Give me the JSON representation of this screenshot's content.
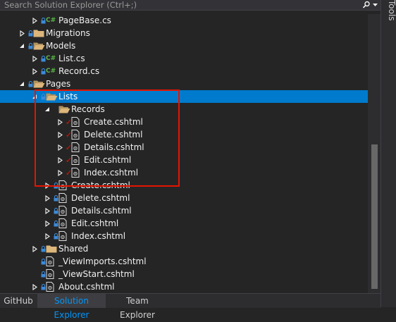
{
  "search": {
    "placeholder": "Search Solution Explorer (Ctrl+;)"
  },
  "side_panel": {
    "label": "Tools"
  },
  "icons": {
    "chevron_collapsed": "chevron-right-outline-icon",
    "chevron_expanded": "chevron-down-filled-icon",
    "lock": "lock-icon",
    "folder": "folder-icon",
    "folder_open": "folder-open-icon",
    "cs_file": "csharp-file-icon",
    "razor_file": "razor-file-icon",
    "pending_edit": "red-checkmark-icon"
  },
  "colors": {
    "background": "#252526",
    "selection": "#007acc",
    "highlight_box": "#e51400",
    "folder": "#dcb67a",
    "cs": "#5ab645",
    "lock": "#3c8ad8",
    "active_tab": "#0097fb"
  },
  "tree": [
    {
      "label": "PageBase.cs",
      "type": "cs",
      "expander": "collapsed",
      "lock": true,
      "checked": false,
      "indent": 3
    },
    {
      "label": "Migrations",
      "type": "folder",
      "expander": "collapsed",
      "lock": true,
      "checked": false,
      "indent": 2
    },
    {
      "label": "Models",
      "type": "folder-open",
      "expander": "expanded",
      "lock": true,
      "checked": false,
      "indent": 2
    },
    {
      "label": "List.cs",
      "type": "cs",
      "expander": "collapsed",
      "lock": true,
      "checked": false,
      "indent": 3
    },
    {
      "label": "Record.cs",
      "type": "cs",
      "expander": "collapsed",
      "lock": true,
      "checked": false,
      "indent": 3
    },
    {
      "label": "Pages",
      "type": "folder-open",
      "expander": "expanded",
      "lock": true,
      "checked": false,
      "indent": 2
    },
    {
      "label": "Lists",
      "type": "folder-open",
      "expander": "expanded",
      "lock": true,
      "checked": false,
      "indent": 3,
      "selected": true
    },
    {
      "label": "Records",
      "type": "folder-open",
      "expander": "expanded",
      "lock": false,
      "checked": false,
      "indent": 4
    },
    {
      "label": "Create.cshtml",
      "type": "razor",
      "expander": "collapsed",
      "lock": false,
      "checked": true,
      "indent": 5
    },
    {
      "label": "Delete.cshtml",
      "type": "razor",
      "expander": "collapsed",
      "lock": false,
      "checked": true,
      "indent": 5
    },
    {
      "label": "Details.cshtml",
      "type": "razor",
      "expander": "collapsed",
      "lock": false,
      "checked": true,
      "indent": 5
    },
    {
      "label": "Edit.cshtml",
      "type": "razor",
      "expander": "collapsed",
      "lock": false,
      "checked": true,
      "indent": 5
    },
    {
      "label": "Index.cshtml",
      "type": "razor",
      "expander": "collapsed",
      "lock": false,
      "checked": true,
      "indent": 5
    },
    {
      "label": "Create.cshtml",
      "type": "razor",
      "expander": "collapsed",
      "lock": true,
      "checked": false,
      "indent": 4
    },
    {
      "label": "Delete.cshtml",
      "type": "razor",
      "expander": "collapsed",
      "lock": true,
      "checked": false,
      "indent": 4
    },
    {
      "label": "Details.cshtml",
      "type": "razor",
      "expander": "collapsed",
      "lock": true,
      "checked": false,
      "indent": 4
    },
    {
      "label": "Edit.cshtml",
      "type": "razor",
      "expander": "collapsed",
      "lock": true,
      "checked": false,
      "indent": 4
    },
    {
      "label": "Index.cshtml",
      "type": "razor",
      "expander": "collapsed",
      "lock": true,
      "checked": false,
      "indent": 4
    },
    {
      "label": "Shared",
      "type": "folder",
      "expander": "collapsed",
      "lock": true,
      "checked": false,
      "indent": 3
    },
    {
      "label": "_ViewImports.cshtml",
      "type": "razor",
      "expander": "none",
      "lock": true,
      "checked": false,
      "indent": 3
    },
    {
      "label": "_ViewStart.cshtml",
      "type": "razor",
      "expander": "none",
      "lock": true,
      "checked": false,
      "indent": 3
    },
    {
      "label": "About.cshtml",
      "type": "razor",
      "expander": "collapsed",
      "lock": true,
      "checked": false,
      "indent": 3
    }
  ],
  "bottom_tabs": [
    {
      "label": "GitHub",
      "active": false
    },
    {
      "label": "Solution Explorer",
      "active": true
    },
    {
      "label": "Team Explorer",
      "active": false
    }
  ]
}
